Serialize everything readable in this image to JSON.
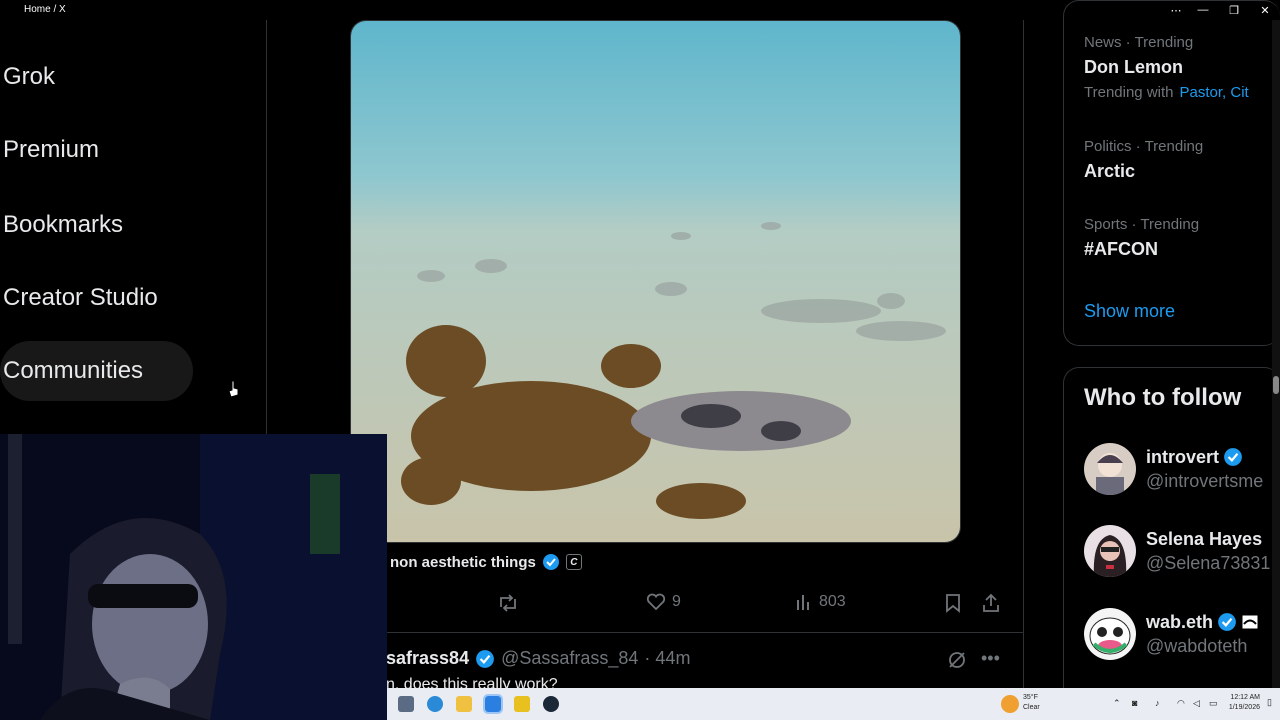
{
  "window": {
    "title": "Home / X",
    "controls": [
      "⋯",
      "—",
      "❐",
      "✕"
    ]
  },
  "left_nav": {
    "items": [
      {
        "label": "Grok",
        "icon": "grok-icon"
      },
      {
        "label": "Premium",
        "icon": "premium-icon"
      },
      {
        "label": "Bookmarks",
        "icon": "bookmark-icon"
      },
      {
        "label": "Creator Studio",
        "icon": "creator-studio-icon"
      },
      {
        "label": "Communities",
        "icon": "communities-icon"
      }
    ]
  },
  "post": {
    "author_display": "non aesthetic things",
    "badge": "C",
    "actions": {
      "repost": "",
      "likes": "9",
      "views": "803"
    }
  },
  "reply": {
    "name": "safrass84",
    "handle": "@Sassafrass_84",
    "time": "· 44m",
    "text": "n, does this really work?"
  },
  "trends": [
    {
      "meta": "News · Trending",
      "name": "Don Lemon",
      "with_label": "Trending with",
      "with_links": "Pastor, Cit"
    },
    {
      "meta": "Politics · Trending",
      "name": "Arctic"
    },
    {
      "meta": "Sports · Trending",
      "name": "#AFCON"
    }
  ],
  "show_more": "Show more",
  "who_to_follow": {
    "title": "Who to follow",
    "accounts": [
      {
        "name": "introvert",
        "handle": "@introvertsme",
        "verified": true
      },
      {
        "name": "Selena Hayes",
        "handle": "@Selena73831",
        "verified": false
      },
      {
        "name": "wab.eth",
        "handle": "@wabdoteth",
        "verified": true
      }
    ]
  },
  "taskbar": {
    "weather_temp": "35°F",
    "weather_desc": "Clear",
    "time": "12:12 AM",
    "date": "1/19/2026"
  },
  "colors": {
    "accent": "#1d9bf0",
    "border": "#2f3336",
    "muted": "#71767b"
  }
}
